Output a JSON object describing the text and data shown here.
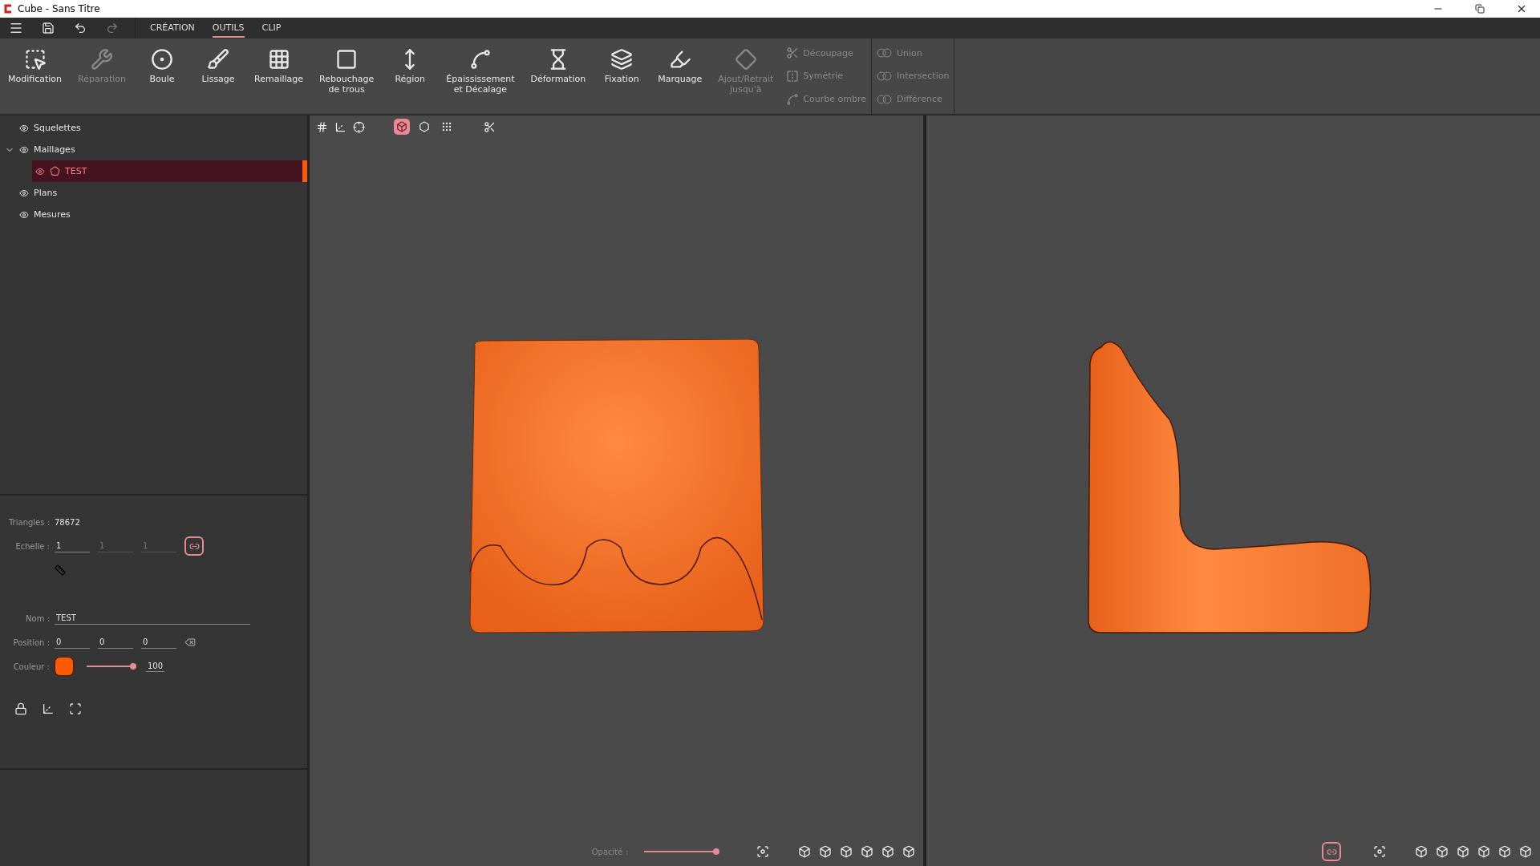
{
  "window": {
    "title": "Cube - Sans Titre"
  },
  "menu_tabs": [
    {
      "label": "CRÉATION",
      "selected": false
    },
    {
      "label": "OUTILS",
      "selected": true
    },
    {
      "label": "CLIP",
      "selected": false
    }
  ],
  "tools": [
    {
      "label": "Modification",
      "disabled": false
    },
    {
      "label": "Réparation",
      "disabled": true
    },
    {
      "label": "Boule",
      "disabled": false
    },
    {
      "label": "Lissage",
      "disabled": false
    },
    {
      "label": "Remaillage",
      "disabled": false
    },
    {
      "label": "Rebouchage\nde trous",
      "disabled": false
    },
    {
      "label": "Région",
      "disabled": false
    },
    {
      "label": "Épaississement\net Décalage",
      "disabled": false
    },
    {
      "label": "Déformation",
      "disabled": false
    },
    {
      "label": "Fixation",
      "disabled": false
    },
    {
      "label": "Marquage",
      "disabled": false
    },
    {
      "label": "Ajout/Retrait\njusqu'à",
      "disabled": true
    }
  ],
  "small_tools": [
    {
      "label": "Découpage",
      "disabled": true
    },
    {
      "label": "Symétrie",
      "disabled": true
    },
    {
      "label": "Courbe ombre",
      "disabled": true
    }
  ],
  "boolean_tools": [
    {
      "label": "Union",
      "disabled": true
    },
    {
      "label": "Intersection",
      "disabled": true
    },
    {
      "label": "Différence",
      "disabled": true
    }
  ],
  "tree": [
    {
      "label": "Squelettes",
      "selected": false
    },
    {
      "label": "Maillages",
      "expanded": true,
      "selected": false,
      "children": [
        {
          "label": "TEST",
          "selected": true
        }
      ]
    },
    {
      "label": "Plans",
      "selected": false
    },
    {
      "label": "Mesures",
      "selected": false
    }
  ],
  "properties": {
    "triangles": {
      "label": "Triangles :",
      "value": "78672"
    },
    "scale": {
      "label": "Echelle :",
      "fields": [
        {
          "value": "1",
          "disabled": false
        },
        {
          "value": "1",
          "disabled": true
        },
        {
          "value": "1",
          "disabled": true
        }
      ],
      "linked": true
    },
    "name": {
      "label": "Nom :",
      "value": "TEST"
    },
    "position": {
      "label": "Position :",
      "fields": [
        "0",
        "0",
        "0"
      ]
    },
    "color": {
      "label": "Couleur :",
      "color": "#ff5a00",
      "level": 1,
      "reading": "100"
    }
  },
  "display_modes": [
    {
      "selected": true
    },
    {
      "selected": false
    },
    {
      "selected": false
    }
  ],
  "viewports": [
    {
      "opacity": {
        "label": "Opacité :",
        "level": 1
      }
    },
    {
      "linked": true
    }
  ]
}
